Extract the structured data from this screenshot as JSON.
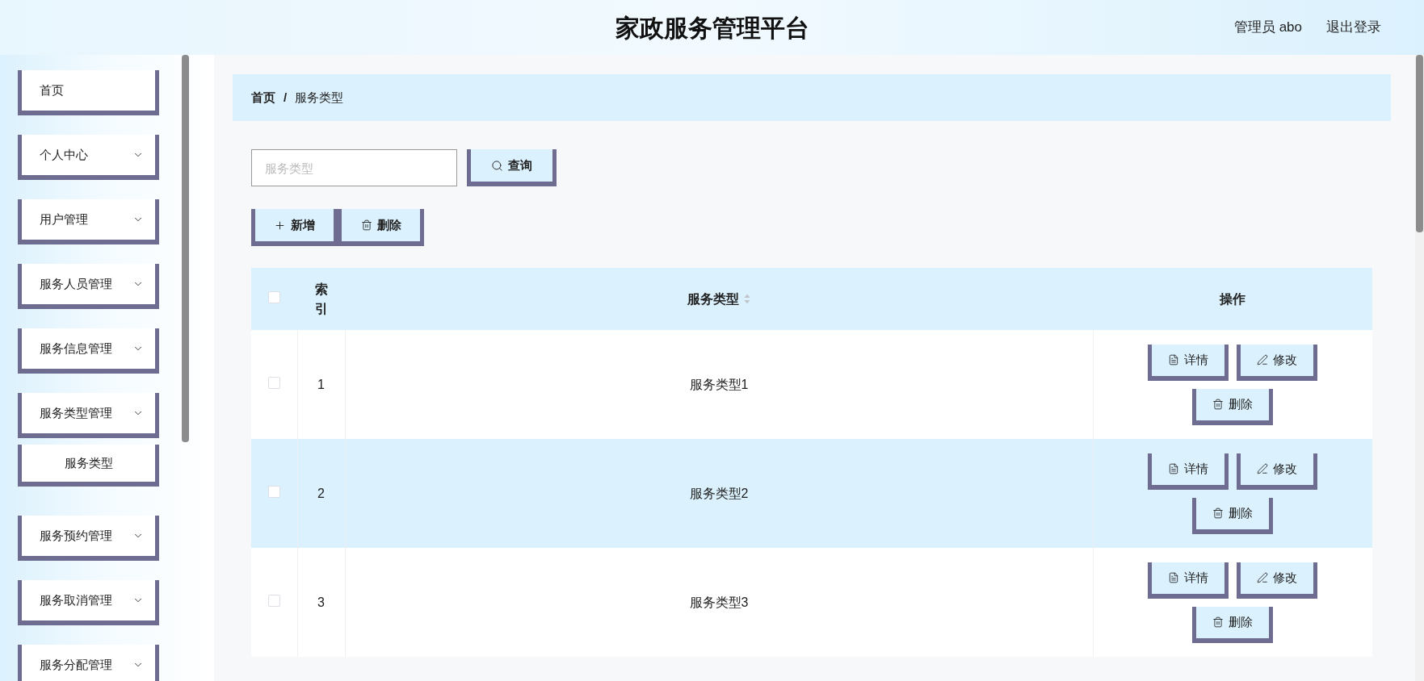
{
  "header": {
    "title": "家政服务管理平台",
    "user": "管理员 abo",
    "logout": "退出登录"
  },
  "sidebar": {
    "items": [
      {
        "label": "首页",
        "kind": "link"
      },
      {
        "label": "个人中心",
        "kind": "menu"
      },
      {
        "label": "用户管理",
        "kind": "menu"
      },
      {
        "label": "服务人员管理",
        "kind": "menu"
      },
      {
        "label": "服务信息管理",
        "kind": "menu"
      },
      {
        "label": "服务类型管理",
        "kind": "menu",
        "children": [
          {
            "label": "服务类型"
          }
        ]
      },
      {
        "label": "服务预约管理",
        "kind": "menu"
      },
      {
        "label": "服务取消管理",
        "kind": "menu"
      },
      {
        "label": "服务分配管理",
        "kind": "menu"
      }
    ]
  },
  "breadcrumb": {
    "items": [
      "首页",
      "服务类型"
    ],
    "separator": "/"
  },
  "search": {
    "placeholder": "服务类型",
    "button": "查询"
  },
  "toolbar": [
    {
      "label": "新增",
      "kind": "add"
    },
    {
      "label": "删除",
      "kind": "delete"
    }
  ],
  "table": {
    "header_checked": false,
    "columns": [
      {
        "label": "索引",
        "sortable": false
      },
      {
        "label": "服务类型",
        "sortable": true
      },
      {
        "label": "操作",
        "sortable": false
      }
    ],
    "rows": [
      {
        "index": "1",
        "name": "服务类型1",
        "checked": false,
        "actions": [
          {
            "label": "详情",
            "kind": "detail"
          },
          {
            "label": "修改",
            "kind": "edit"
          },
          {
            "label": "删除",
            "kind": "delete"
          }
        ]
      },
      {
        "index": "2",
        "name": "服务类型2",
        "checked": false,
        "actions": [
          {
            "label": "详情",
            "kind": "detail"
          },
          {
            "label": "修改",
            "kind": "edit"
          },
          {
            "label": "删除",
            "kind": "delete"
          }
        ]
      },
      {
        "index": "3",
        "name": "服务类型3",
        "checked": false,
        "actions": [
          {
            "label": "详情",
            "kind": "detail"
          },
          {
            "label": "修改",
            "kind": "edit"
          },
          {
            "label": "删除",
            "kind": "delete"
          }
        ]
      }
    ]
  }
}
